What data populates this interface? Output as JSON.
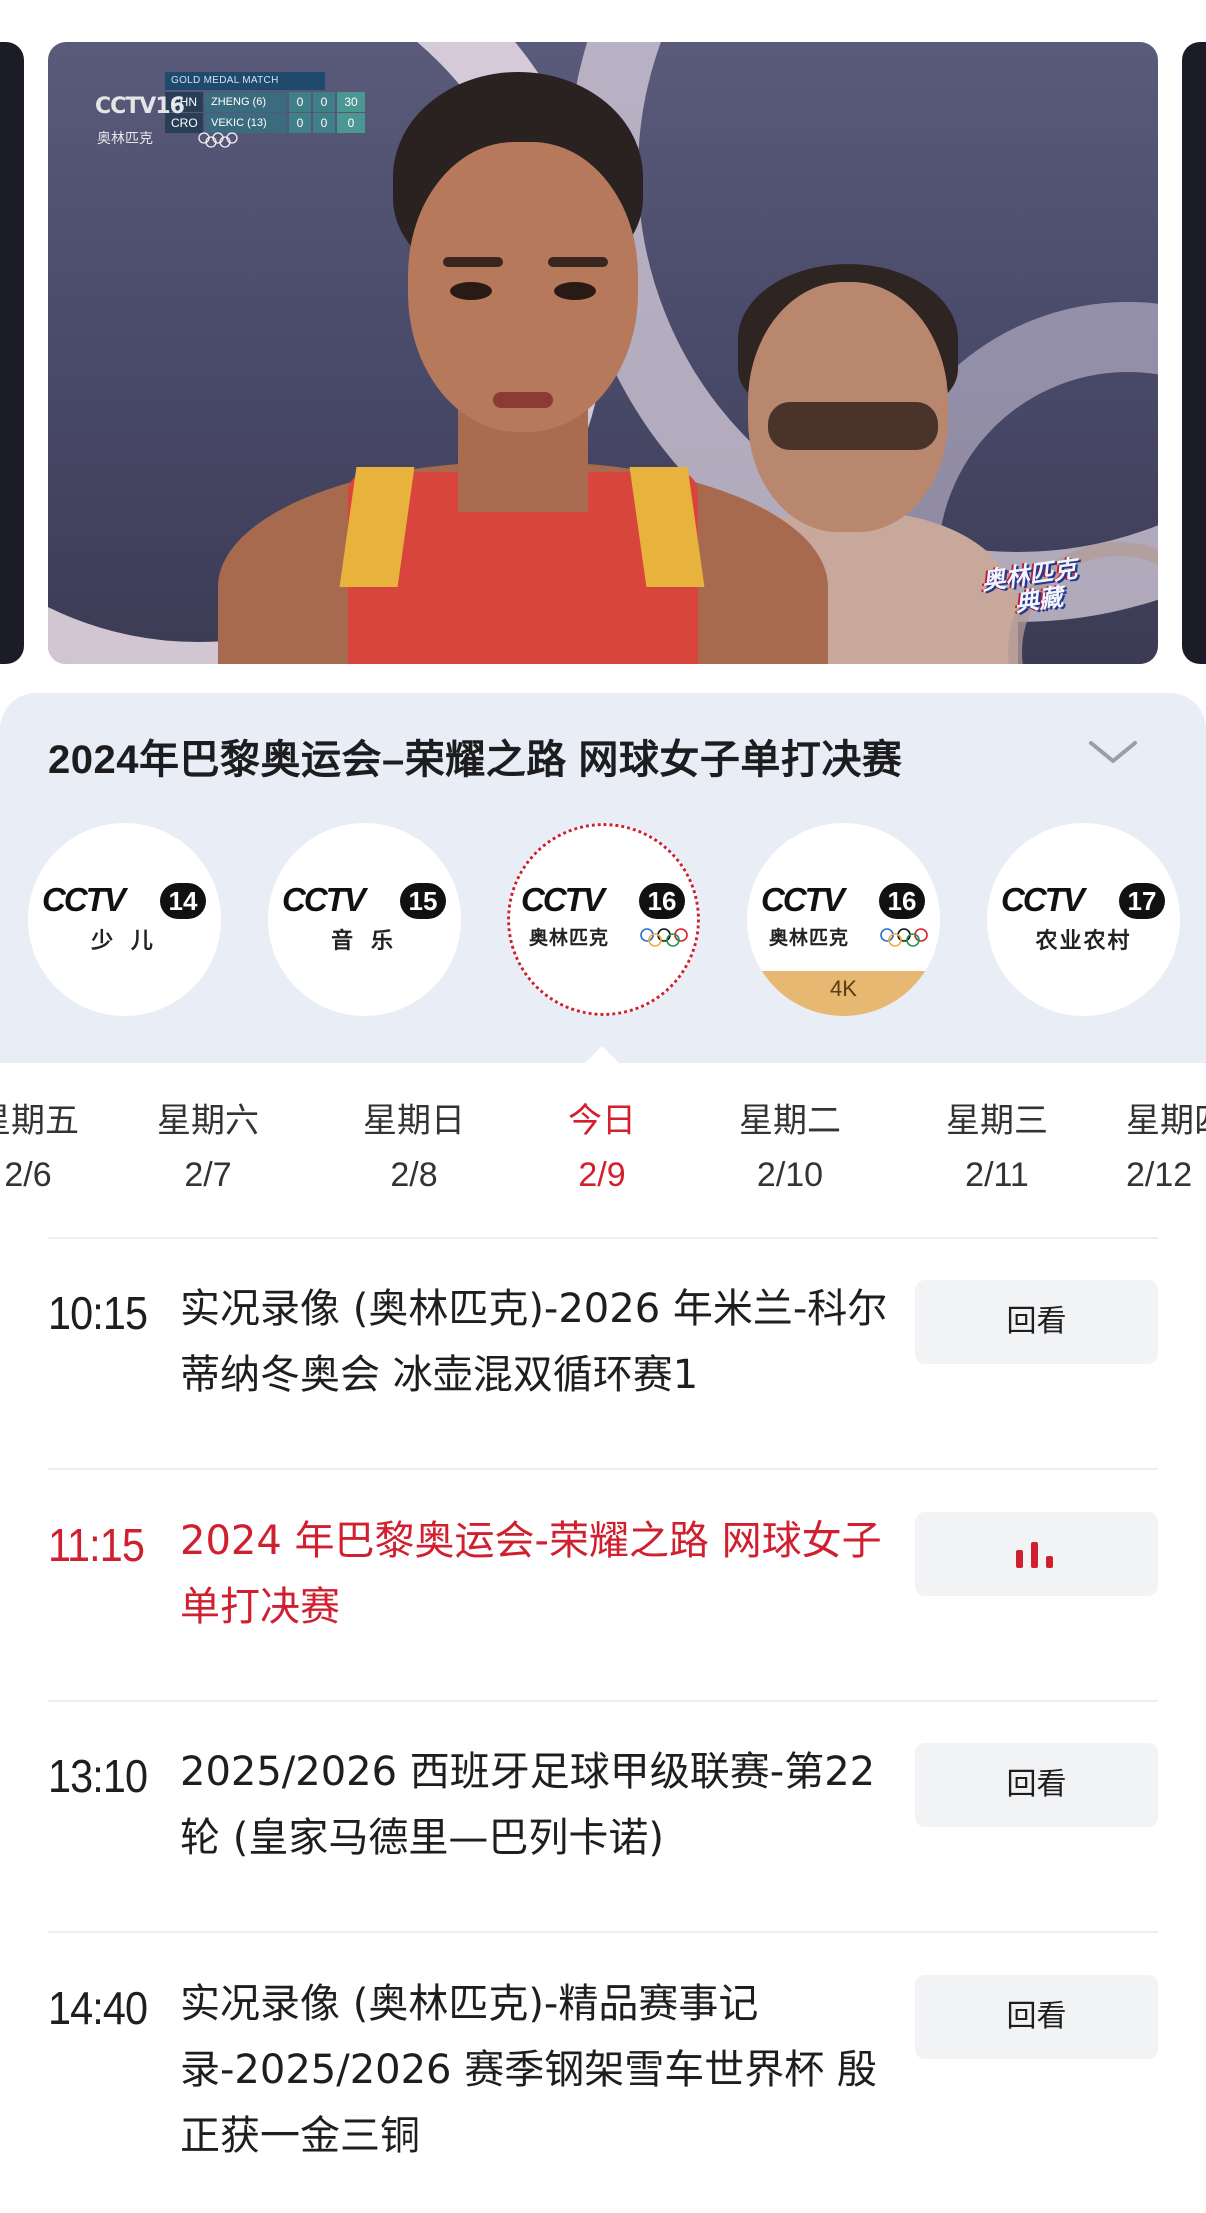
{
  "player": {
    "scoreboard": {
      "title": "GOLD MEDAL MATCH",
      "rows": [
        {
          "country": "CHN",
          "name": "ZHENG (6)",
          "s1": "0",
          "s2": "0",
          "s3": "30"
        },
        {
          "country": "CRO",
          "name": "VEKIC (13)",
          "s1": "0",
          "s2": "0",
          "s3": "0"
        }
      ]
    },
    "channel_watermark": "CCTV16",
    "channel_watermark_sub": "奥林匹克",
    "badge_line1": "奥林匹克",
    "badge_line2": "典藏"
  },
  "program": {
    "title": "2024年巴黎奥运会–荣耀之路 网球女子单打决赛"
  },
  "channels": [
    {
      "word": "CCTV",
      "number": "14",
      "sub": "少 儿",
      "selected": false
    },
    {
      "word": "CCTV",
      "number": "15",
      "sub": "音 乐",
      "selected": false
    },
    {
      "word": "CCTV",
      "number": "16",
      "sub": "奥林匹克",
      "selected": true
    },
    {
      "word": "CCTV",
      "number": "16",
      "sub": "奥林匹克",
      "tag": "4K",
      "selected": false
    },
    {
      "word": "CCTV",
      "number": "17",
      "sub": "农业农村",
      "selected": false
    }
  ],
  "days": [
    {
      "weekday": "星期五",
      "date": "2/6"
    },
    {
      "weekday": "星期六",
      "date": "2/7"
    },
    {
      "weekday": "星期日",
      "date": "2/8"
    },
    {
      "weekday": "今日",
      "date": "2/9",
      "today": true
    },
    {
      "weekday": "星期二",
      "date": "2/10"
    },
    {
      "weekday": "星期三",
      "date": "2/11"
    },
    {
      "weekday": "星期四",
      "date": "2/12"
    }
  ],
  "schedule": [
    {
      "time": "10:15",
      "title": "实况录像 (奥林匹克)-2026 年米兰-科尔蒂纳冬奥会 冰壶混双循环赛1",
      "action": "回看"
    },
    {
      "time": "11:15",
      "title": "2024 年巴黎奥运会-荣耀之路 网球女子单打决赛",
      "action": "",
      "live": true
    },
    {
      "time": "13:10",
      "title": "2025/2026 西班牙足球甲级联赛-第22轮 (皇家马德里—巴列卡诺)",
      "action": "回看"
    },
    {
      "time": "14:40",
      "title": "实况录像 (奥林匹克)-精品赛事记录-2025/2026 赛季钢架雪车世界杯 殷正获一金三铜",
      "action": "回看"
    }
  ],
  "colors": {
    "accent_red": "#d0202f",
    "card_bg": "#e8edf6",
    "button_bg": "#f2f3f5",
    "tag_4k": "#e6b872"
  }
}
